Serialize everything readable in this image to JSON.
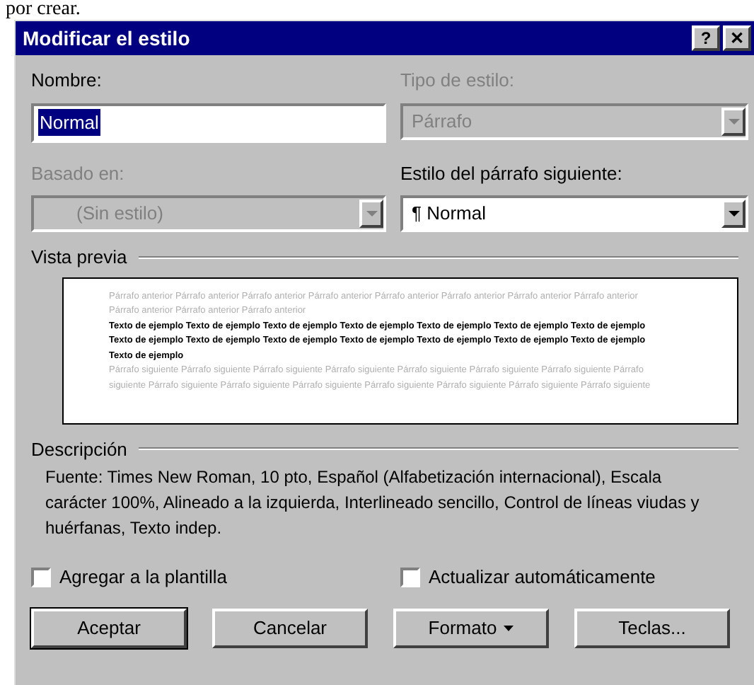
{
  "page_text": "por crear.",
  "window": {
    "title": "Modificar el estilo",
    "title_buttons": [
      "?",
      "✕"
    ]
  },
  "name_field": {
    "label": "Nombre:",
    "value": "Normal",
    "selected_text": true
  },
  "style_type": {
    "label": "Tipo de estilo:",
    "value": "Párrafo",
    "disabled": true
  },
  "based_on": {
    "label": "Basado en:",
    "value": "(Sin estilo)",
    "disabled": true
  },
  "next_style": {
    "label": "Estilo del párrafo siguiente:",
    "value": "¶ Normal",
    "disabled": false
  },
  "preview": {
    "label": "Vista previa",
    "paragraphs": [
      {
        "kind": "previous",
        "text": "Párrafo anterior Párrafo anterior Párrafo anterior Párrafo anterior Párrafo anterior Párrafo anterior Párrafo anterior Párrafo anterior Párrafo anterior Párrafo anterior Párrafo anterior"
      },
      {
        "kind": "sample",
        "text": "Texto de ejemplo Texto de ejemplo Texto de ejemplo Texto de ejemplo Texto de ejemplo Texto de ejemplo Texto de ejemplo Texto de ejemplo Texto de ejemplo Texto de ejemplo Texto de ejemplo Texto de ejemplo Texto de ejemplo Texto de ejemplo Texto de ejemplo"
      },
      {
        "kind": "next",
        "text": "Párrafo siguiente Párrafo siguiente Párrafo siguiente Párrafo siguiente Párrafo siguiente Párrafo siguiente Párrafo siguiente Párrafo siguiente Párrafo siguiente Párrafo siguiente Párrafo siguiente Párrafo siguiente Párrafo siguiente Párrafo siguiente Párrafo siguiente"
      }
    ]
  },
  "description": {
    "label": "Descripción",
    "text": "Fuente: Times New Roman, 10 pto, Español (Alfabetización internacional), Escala carácter 100%, Alineado a la izquierda, Interlineado sencillo, Control de líneas viudas y huérfanas, Texto indep."
  },
  "checkboxes": [
    {
      "label": "Agregar a la plantilla",
      "checked": false
    },
    {
      "label": "Actualizar automáticamente",
      "checked": false
    }
  ],
  "buttons": [
    {
      "label": "Aceptar",
      "default": true,
      "menu": false
    },
    {
      "label": "Cancelar",
      "default": false,
      "menu": false
    },
    {
      "label": "Formato",
      "default": false,
      "menu": true
    },
    {
      "label": "Teclas...",
      "default": false,
      "menu": false
    }
  ]
}
